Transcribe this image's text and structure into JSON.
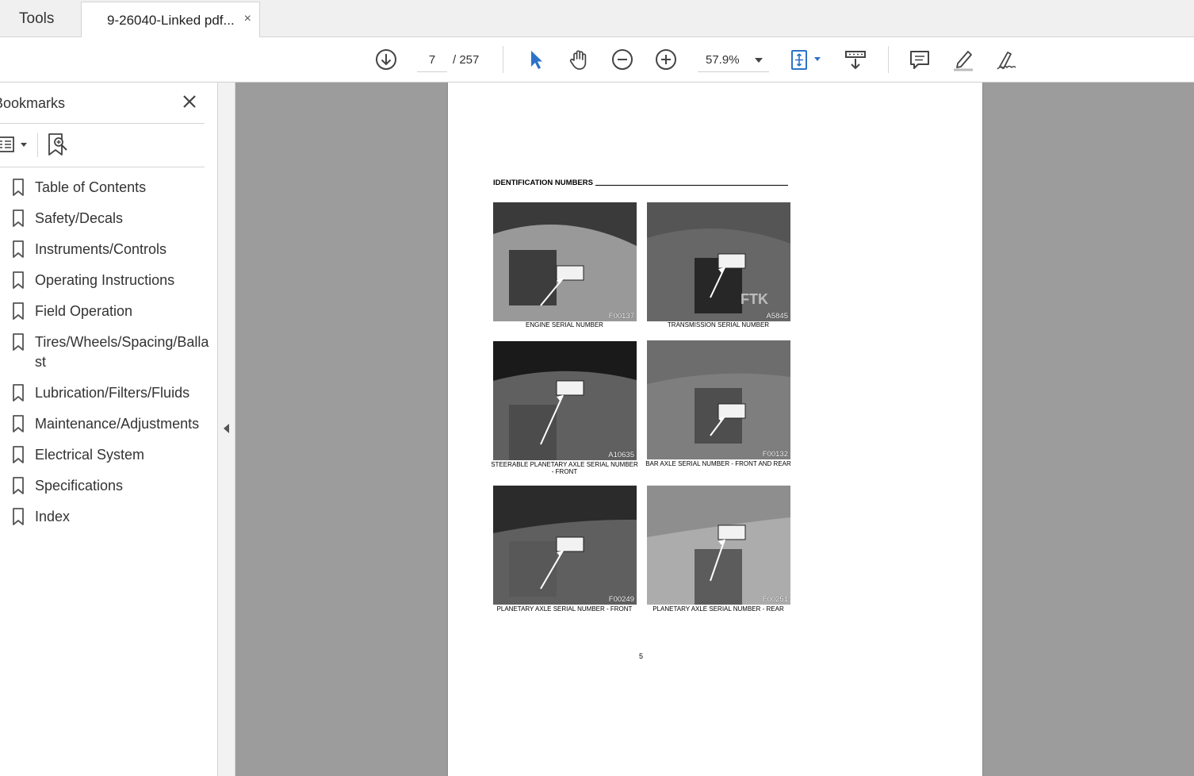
{
  "tabs": {
    "tools_label": "Tools",
    "doc_label": "9-26040-Linked pdf...",
    "close_glyph": "×"
  },
  "toolbar": {
    "current_page": "7",
    "total_pages": "/ 257",
    "zoom": "57.9%",
    "icons": [
      "download-icon",
      "select-arrow-icon",
      "hand-icon",
      "zoom-out-icon",
      "zoom-in-icon",
      "fit-page-icon",
      "scroll-mode-icon",
      "comment-icon",
      "highlight-icon",
      "sign-icon"
    ],
    "accent_color": "#2d72c8"
  },
  "sidebar": {
    "title": "Bookmarks",
    "items": [
      {
        "label": "Table of Contents"
      },
      {
        "label": "Safety/Decals"
      },
      {
        "label": "Instruments/Controls"
      },
      {
        "label": "Operating Instructions"
      },
      {
        "label": "Field Operation"
      },
      {
        "label": "Tires/Wheels/Spacing/Ballast"
      },
      {
        "label": "Lubrication/Filters/Fluids"
      },
      {
        "label": "Maintenance/Adjustments"
      },
      {
        "label": "Electrical System"
      },
      {
        "label": "Specifications"
      },
      {
        "label": "Index"
      }
    ]
  },
  "document": {
    "heading": "IDENTIFICATION NUMBERS",
    "page_number": "5",
    "photos": [
      {
        "code": "F00137",
        "caption": "ENGINE SERIAL NUMBER"
      },
      {
        "code": "A5845",
        "caption": "TRANSMISSION SERIAL NUMBER"
      },
      {
        "code": "A10635",
        "caption": "STEERABLE PLANETARY AXLE SERIAL NUMBER - FRONT"
      },
      {
        "code": "F00132",
        "caption": "BAR AXLE SERIAL NUMBER - FRONT AND REAR"
      },
      {
        "code": "F00249",
        "caption": "PLANETARY AXLE SERIAL NUMBER - FRONT"
      },
      {
        "code": "F00251",
        "caption": "PLANETARY AXLE SERIAL NUMBER - REAR"
      }
    ],
    "photo_overlay_text": "FTK"
  }
}
